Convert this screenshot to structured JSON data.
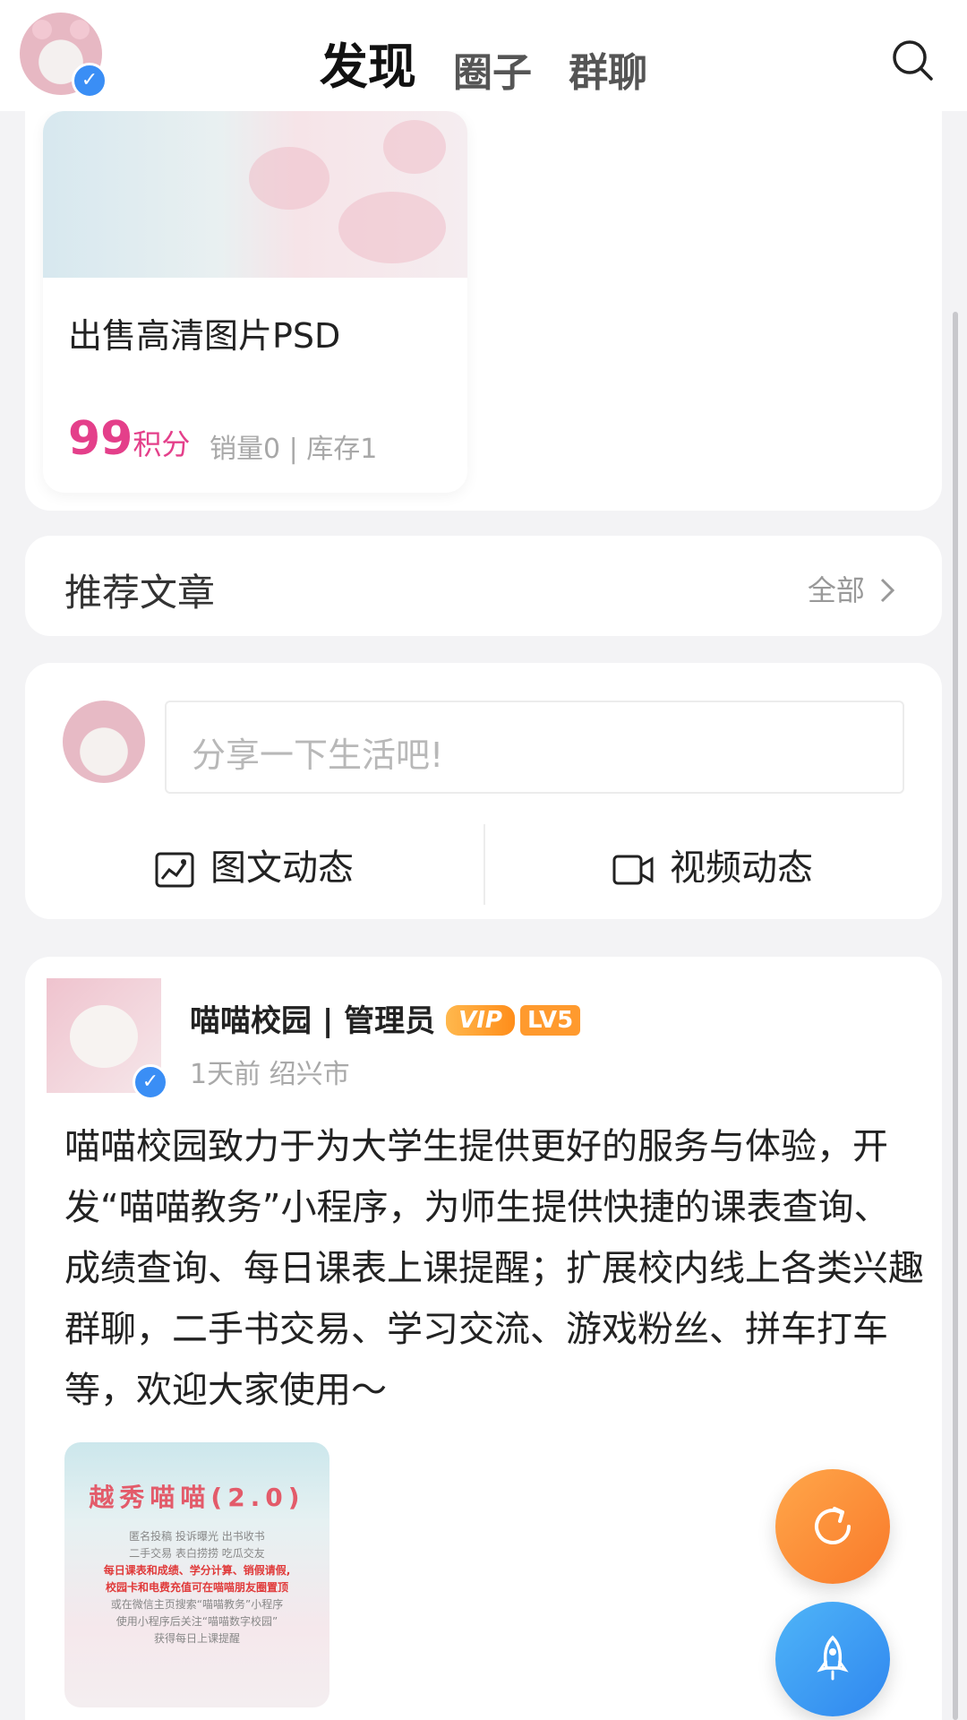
{
  "nav": {
    "tabs": [
      {
        "label": "发现",
        "active": true
      },
      {
        "label": "圈子",
        "active": false
      },
      {
        "label": "群聊",
        "active": false
      }
    ]
  },
  "product": {
    "title": "出售高清图片PSD",
    "price": "99",
    "price_unit": "积分",
    "stock": "销量0 | 库存1"
  },
  "articles": {
    "title": "推荐文章",
    "all_label": "全部"
  },
  "composer": {
    "placeholder": "分享一下生活吧!",
    "actions": [
      {
        "label": "图文动态",
        "icon": "image-icon"
      },
      {
        "label": "视频动态",
        "icon": "video-icon"
      }
    ]
  },
  "post": {
    "author": "喵喵校园 | 管理员",
    "vip_label": "VIP",
    "level_label": "LV5",
    "meta": "1天前 绍兴市",
    "content": "喵喵校园致力于为大学生提供更好的服务与体验，开发“喵喵教务”小程序，为师生提供快捷的课表查询、成绩查询、每日课表上课提醒；扩展校内线上各类兴趣群聊，二手书交易、学习交流、游戏粉丝、拼车打车等，欢迎大家使用～",
    "image": {
      "title": "越秀喵喵(2.0)",
      "lines": [
        "匿名投稿  投诉曝光  出书收书",
        "二手交易  表白捞捞  吃瓜交友",
        "每日课表和成绩、学分计算、销假请假,",
        "校园卡和电费充值可在喵喵朋友圈置顶",
        "或在微信主页搜索“喵喵教务”小程序",
        "使用小程序后关注“喵喵数字校园”",
        "获得每日上课提醒"
      ]
    }
  },
  "colors": {
    "accent_pink": "#e43f8a",
    "fab_orange": "#f9792a",
    "fab_blue": "#2f86ef",
    "verify_blue": "#3a8ef5"
  }
}
